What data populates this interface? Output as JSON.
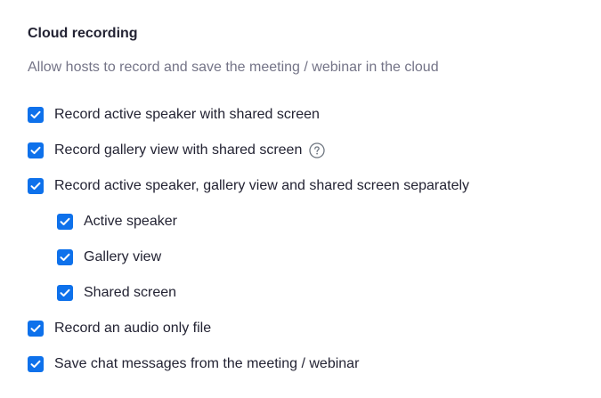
{
  "section": {
    "title": "Cloud recording",
    "description": "Allow hosts to record and save the meeting / webinar in the cloud"
  },
  "options": [
    {
      "label": "Record active speaker with shared screen",
      "checked": true
    },
    {
      "label": "Record gallery view with shared screen",
      "checked": true,
      "help_icon": "question-circle-icon"
    },
    {
      "label": "Record active speaker, gallery view and shared screen separately",
      "checked": true
    },
    {
      "label": "Active speaker",
      "checked": true
    },
    {
      "label": "Gallery view",
      "checked": true
    },
    {
      "label": "Shared screen",
      "checked": true
    },
    {
      "label": "Record an audio only file",
      "checked": true
    },
    {
      "label": "Save chat messages from the meeting / webinar",
      "checked": true
    }
  ],
  "colors": {
    "checkbox_fill": "#0e71eb",
    "text": "#232333",
    "muted_text": "#747487"
  }
}
